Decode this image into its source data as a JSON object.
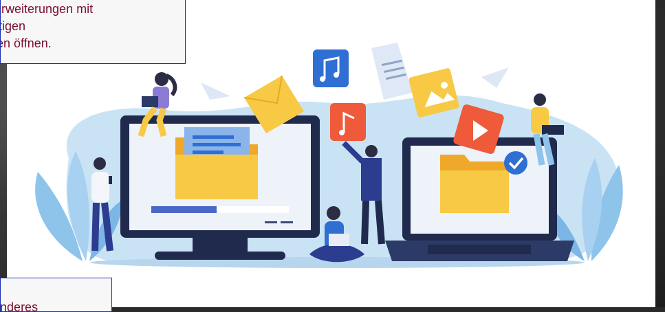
{
  "tooltips": {
    "top_lines": [
      "n Erweiterungen mit",
      "ichtigen",
      "ngen öffnen."
    ],
    "bottom_line": "ein anderes"
  },
  "illustration": {
    "subject": "file-sharing-illustration",
    "icons": [
      "music-icon",
      "document-icon",
      "image-icon",
      "play-icon",
      "email-icon",
      "paper-plane-icon",
      "checkmark-icon"
    ],
    "colors": {
      "blob": "#c9e3f4",
      "monitor": "#1f2a4d",
      "folder": "#f5b935",
      "folder_back": "#f0a82a",
      "accent_blue": "#2f6fd4",
      "accent_red": "#ee5a3a",
      "accent_yellow": "#f7c945",
      "plant": "#8ec3ea"
    }
  }
}
